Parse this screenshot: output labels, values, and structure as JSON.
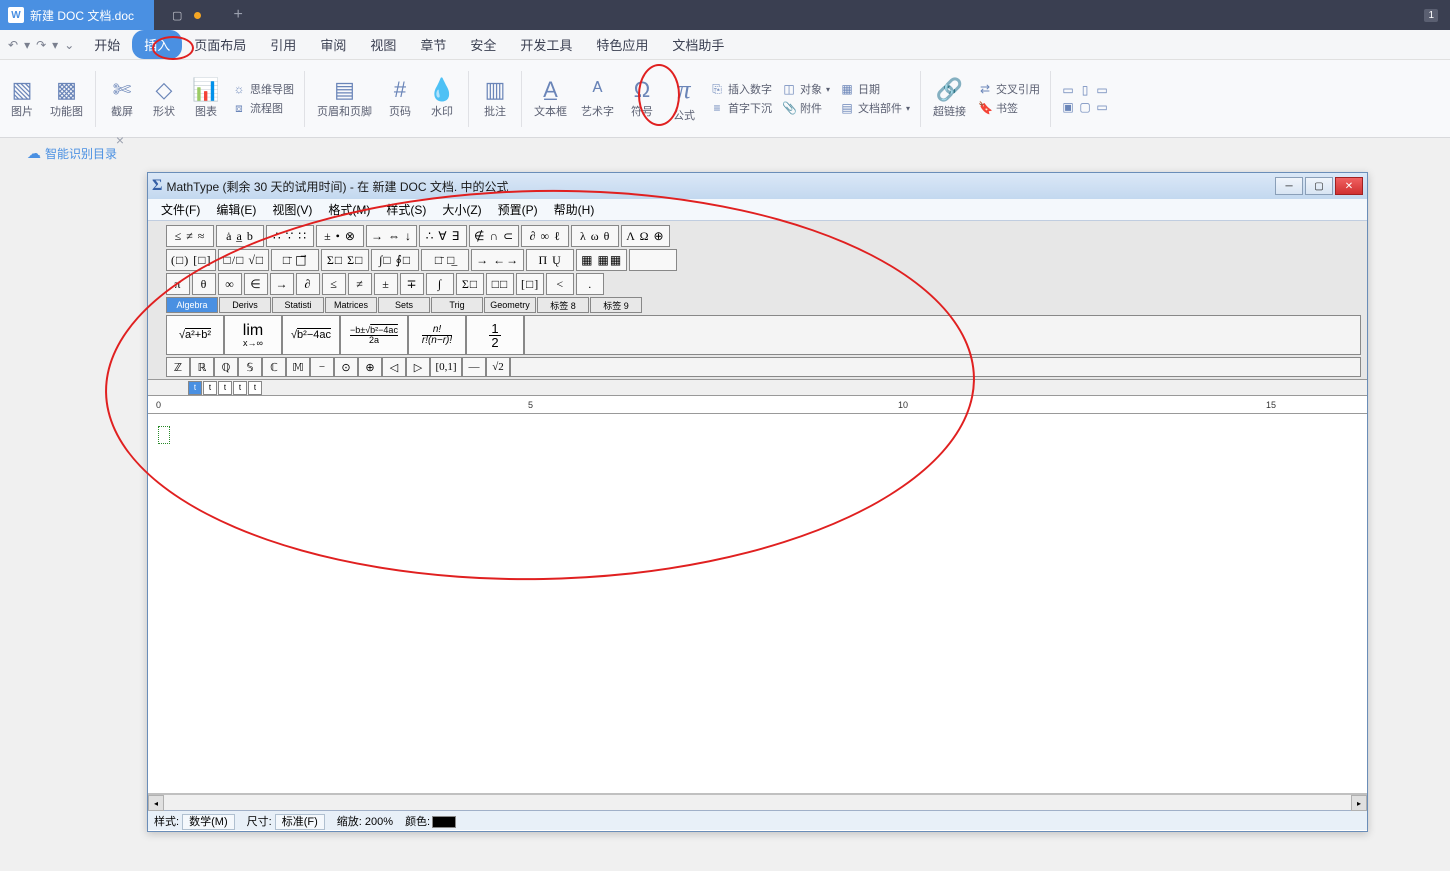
{
  "titlebar": {
    "doc_name": "新建 DOC 文档.doc",
    "badge": "1"
  },
  "qat": {
    "undo": "↶",
    "redo": "↷"
  },
  "menu_tabs": [
    "开始",
    "插入",
    "页面布局",
    "引用",
    "审阅",
    "视图",
    "章节",
    "安全",
    "开发工具",
    "特色应用",
    "文档助手"
  ],
  "menu_active_idx": 1,
  "ribbon": {
    "g1": "图片",
    "g2": "功能图",
    "g3": "截屏",
    "g4": "形状",
    "g5": "图表",
    "g6": "思维导图",
    "g7": "流程图",
    "g8": "页眉和页脚",
    "g9": "页码",
    "g10": "水印",
    "g11": "批注",
    "g12": "文本框",
    "g13": "艺术字",
    "g14": "符号",
    "g15": "公式",
    "s1": "插入数字",
    "s2": "首字下沉",
    "s3": "对象",
    "s4": "附件",
    "s5": "日期",
    "s6": "文档部件",
    "g16": "超链接",
    "s7": "交叉引用",
    "s8": "书签"
  },
  "leftpanel": {
    "label": "智能识别目录"
  },
  "mathtype": {
    "title": "MathType (剩余 30 天的试用时间) - 在 新建 DOC 文档. 中的公式",
    "menus": [
      "文件(F)",
      "编辑(E)",
      "视图(V)",
      "格式(M)",
      "样式(S)",
      "大小(Z)",
      "预置(P)",
      "帮助(H)"
    ],
    "row1": [
      "≤ ≠ ≈",
      "ȧ a̲ b",
      "∴ ∵ ∷",
      "± • ⊗",
      "→ ⇔ ↓",
      "∴ ∀ ∃",
      "∉ ∩ ⊂",
      "∂ ∞ ℓ",
      "λ ω θ",
      "Λ Ω ⊕"
    ],
    "row2": [
      "(□) [□]",
      "□/□ √□",
      "□̄ □⃗",
      "Σ□ Σ□",
      "∫□ ∮□",
      "□̄ □̲",
      "→ ←→",
      "Π Ų",
      "▦ ▦▦",
      "  "
    ],
    "row3": [
      "π",
      "θ",
      "∞",
      "∈",
      "→",
      "∂",
      "≤",
      "≠",
      "±",
      "∓",
      "∫",
      "Σ□",
      "□□",
      "[□]",
      "<",
      "."
    ],
    "cats": [
      "Algebra",
      "Derivs",
      "Statisti",
      "Matrices",
      "Sets",
      "Trig",
      "Geometry",
      "标签 8",
      "标签 9"
    ],
    "cat_active": 0,
    "templates": [
      "√(a²+b²)",
      "lim x→∞",
      "√(b²−4ac)",
      "(−b±√(b²−4ac))/2a",
      "n!/(r!(n−r)!)",
      "1/2"
    ],
    "smalls": [
      "ℤ",
      "ℝ",
      "ℚ",
      "𝕊",
      "ℂ",
      "𝕄",
      "−",
      "⊙",
      "⊕",
      "◁",
      "▷",
      "[0,1]",
      "—",
      "√2"
    ],
    "ruler_marks": [
      "0",
      "5",
      "10",
      "15"
    ],
    "tabs": [
      "t",
      "t",
      "t",
      "t",
      "t"
    ],
    "status": {
      "style_label": "样式:",
      "style_value": "数学(M)",
      "size_label": "尺寸:",
      "size_value": "标准(F)",
      "zoom_label": "缩放:",
      "zoom_value": "200%",
      "color_label": "颜色:"
    }
  }
}
